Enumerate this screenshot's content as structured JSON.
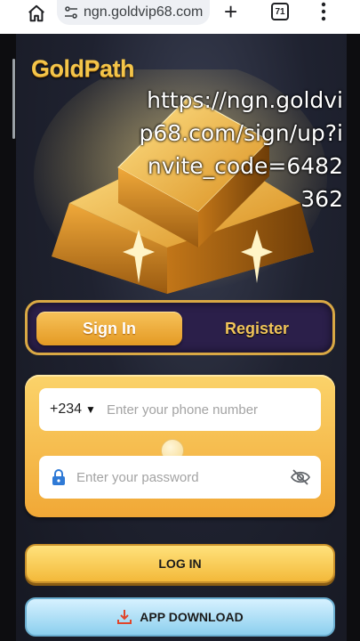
{
  "browser": {
    "url": "ngn.goldvip68.com",
    "tab_count": "71",
    "new_tab": "+"
  },
  "app": {
    "logo": "GoldPath",
    "overlay_url": "https://ngn.goldvip68.com/sign/up?invite_code=6482362",
    "tabs": {
      "signin_label": "Sign In",
      "register_label": "Register",
      "active": "Sign In"
    },
    "form": {
      "country_code": "+234",
      "phone_placeholder": "Enter your phone number",
      "password_placeholder": "Enter your password"
    },
    "buttons": {
      "login_label": "LOG IN",
      "download_label": "APP DOWNLOAD"
    }
  },
  "colors": {
    "accent_gold": "#f4c54a",
    "tab_active": "#e49a24",
    "tab_bg": "#2b1f4a",
    "download_blue": "#8ccfee"
  }
}
